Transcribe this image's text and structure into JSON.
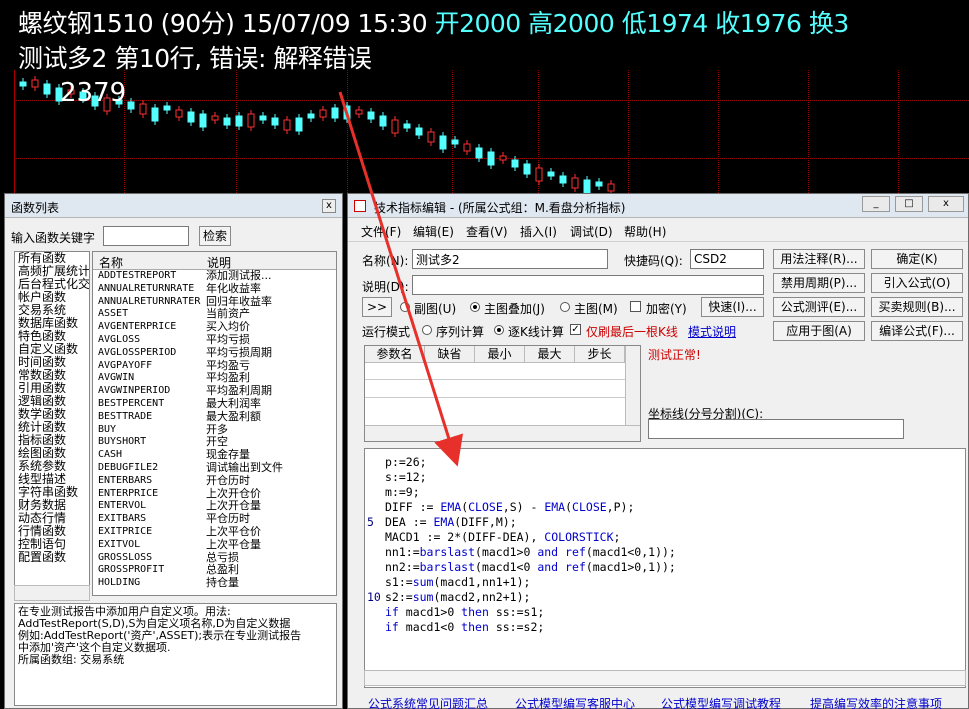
{
  "chart": {
    "header": "螺纹钢1510 (90分) 15/07/09 15:30",
    "ohlc": "开2000  高2000  低1974  收1976  换3",
    "subtitle": "测试多2   第10行, 错误: 解释错误",
    "price_label": "2379",
    "colors": {
      "up": "#ff3030",
      "down": "#54ffff",
      "grid": "#9a0000",
      "background": "#000000"
    }
  },
  "fn_window": {
    "title": "函数列表",
    "close": "x",
    "search_label": "输入函数关键字",
    "search_value": "",
    "search_button": "检索",
    "categories": [
      "所有函数",
      "高频扩展统计",
      "后台程式化交",
      "帐户函数",
      "交易系统",
      "数据库函数",
      "特色函数",
      "自定义函数",
      "时间函数",
      "常数函数",
      "引用函数",
      "逻辑函数",
      "数学函数",
      "统计函数",
      "指标函数",
      "绘图函数",
      "系统参数",
      "线型描述",
      "字符串函数",
      "财务数据",
      "动态行情",
      "行情函数",
      "控制语句",
      "配置函数"
    ],
    "columns": [
      "名称",
      "说明"
    ],
    "functions": [
      {
        "name": "ADDTESTREPORT",
        "desc": "添加测试报..."
      },
      {
        "name": "ANNUALRETURNRATE",
        "desc": "年化收益率"
      },
      {
        "name": "ANNUALRETURNRATER",
        "desc": "回归年收益率"
      },
      {
        "name": "ASSET",
        "desc": "当前资产"
      },
      {
        "name": "AVGENTERPRICE",
        "desc": "买入均价"
      },
      {
        "name": "AVGLOSS",
        "desc": "平均亏损"
      },
      {
        "name": "AVGLOSSPERIOD",
        "desc": "平均亏损周期"
      },
      {
        "name": "AVGPAYOFF",
        "desc": "平均盈亏"
      },
      {
        "name": "AVGWIN",
        "desc": "平均盈利"
      },
      {
        "name": "AVGWINPERIOD",
        "desc": "平均盈利周期"
      },
      {
        "name": "BESTPERCENT",
        "desc": "最大利润率"
      },
      {
        "name": "BESTTRADE",
        "desc": "最大盈利额"
      },
      {
        "name": "BUY",
        "desc": "开多"
      },
      {
        "name": "BUYSHORT",
        "desc": "开空"
      },
      {
        "name": "CASH",
        "desc": "现金存量"
      },
      {
        "name": "DEBUGFILE2",
        "desc": "调试输出到文件"
      },
      {
        "name": "ENTERBARS",
        "desc": "开仓历时"
      },
      {
        "name": "ENTERPRICE",
        "desc": "上次开仓价"
      },
      {
        "name": "ENTERVOL",
        "desc": "上次开仓量"
      },
      {
        "name": "EXITBARS",
        "desc": "平仓历时"
      },
      {
        "name": "EXITPRICE",
        "desc": "上次平仓价"
      },
      {
        "name": "EXITVOL",
        "desc": "上次平仓量"
      },
      {
        "name": "GROSSLOSS",
        "desc": "总亏损"
      },
      {
        "name": "GROSSPROFIT",
        "desc": "总盈利"
      },
      {
        "name": "HOLDING",
        "desc": "持仓量"
      }
    ],
    "description": [
      "在专业测试报告中添加用户自定义项。用法:",
      "AddTestReport(S,D),S为自定义项名称,D为自定义数据",
      "例如:AddTestReport('资产',ASSET);表示在专业测试报告",
      "中添加'资产'这个自定义数据项.",
      "所属函数组: 交易系统"
    ]
  },
  "editor": {
    "title": "技术指标编辑 - (所属公式组：M.看盘分析指标)",
    "window_controls": [
      "_",
      "□",
      "x"
    ],
    "menu": [
      "文件(F)",
      "编辑(E)",
      "查看(V)",
      "插入(I)",
      "调试(D)",
      "帮助(H)"
    ],
    "name_label": "名称(N):",
    "name_value": "测试多2",
    "shortcut_label": "快捷码(Q):",
    "shortcut_value": "CSD2",
    "desc_label": "说明(D):",
    "desc_value": "",
    "expand_button": ">>",
    "chart_modes": [
      "副图(U)",
      "主图叠加(J)",
      "主图(M)"
    ],
    "encrypt_label": "加密(Y)",
    "quick_button": "快速(I)...",
    "run_mode_label": "运行模式",
    "run_modes": [
      "序列计算",
      "逐K线计算"
    ],
    "last_bar_label": "仅刷最后一根K线",
    "mode_help_link": "模式说明",
    "right_buttons": [
      [
        "用法注释(R)...",
        "确定(K)"
      ],
      [
        "禁用周期(P)...",
        "引入公式(O)"
      ],
      [
        "公式测评(E)...",
        "买卖规则(B)..."
      ],
      [
        "应用于图(A)",
        "编译公式(F)..."
      ]
    ],
    "param_columns": [
      "参数名",
      "缺省",
      "最小",
      "最大",
      "步长"
    ],
    "status": "测试正常!",
    "axis_label": "坐标线(分号分割)(C):",
    "axis_value": "",
    "code_lines": [
      "p:=26;",
      "s:=12;",
      "m:=9;",
      "DIFF := EMA(CLOSE,S) - EMA(CLOSE,P);",
      "DEA  := EMA(DIFF,M);",
      "MACD1 := 2*(DIFF-DEA), COLORSTICK;",
      "nn1:=barslast(macd1>0 and ref(macd1<0,1));",
      "nn2:=barslast(macd1<0 and ref(macd1>0,1));",
      "s1:=sum(macd1,nn1+1);",
      "s2:=sum(macd2,nn2+1);",
      "if macd1>0 then ss:=s1;",
      "if macd1<0 then ss:=s2;"
    ],
    "line_numbers": [
      {
        "at": 5,
        "label": "5"
      },
      {
        "at": 10,
        "label": "10"
      }
    ],
    "footer_links": [
      "公式系统常见问题汇总",
      "公式模型编写客服中心",
      "公式模型编写调试教程",
      "提高编写效率的注意事项"
    ]
  }
}
